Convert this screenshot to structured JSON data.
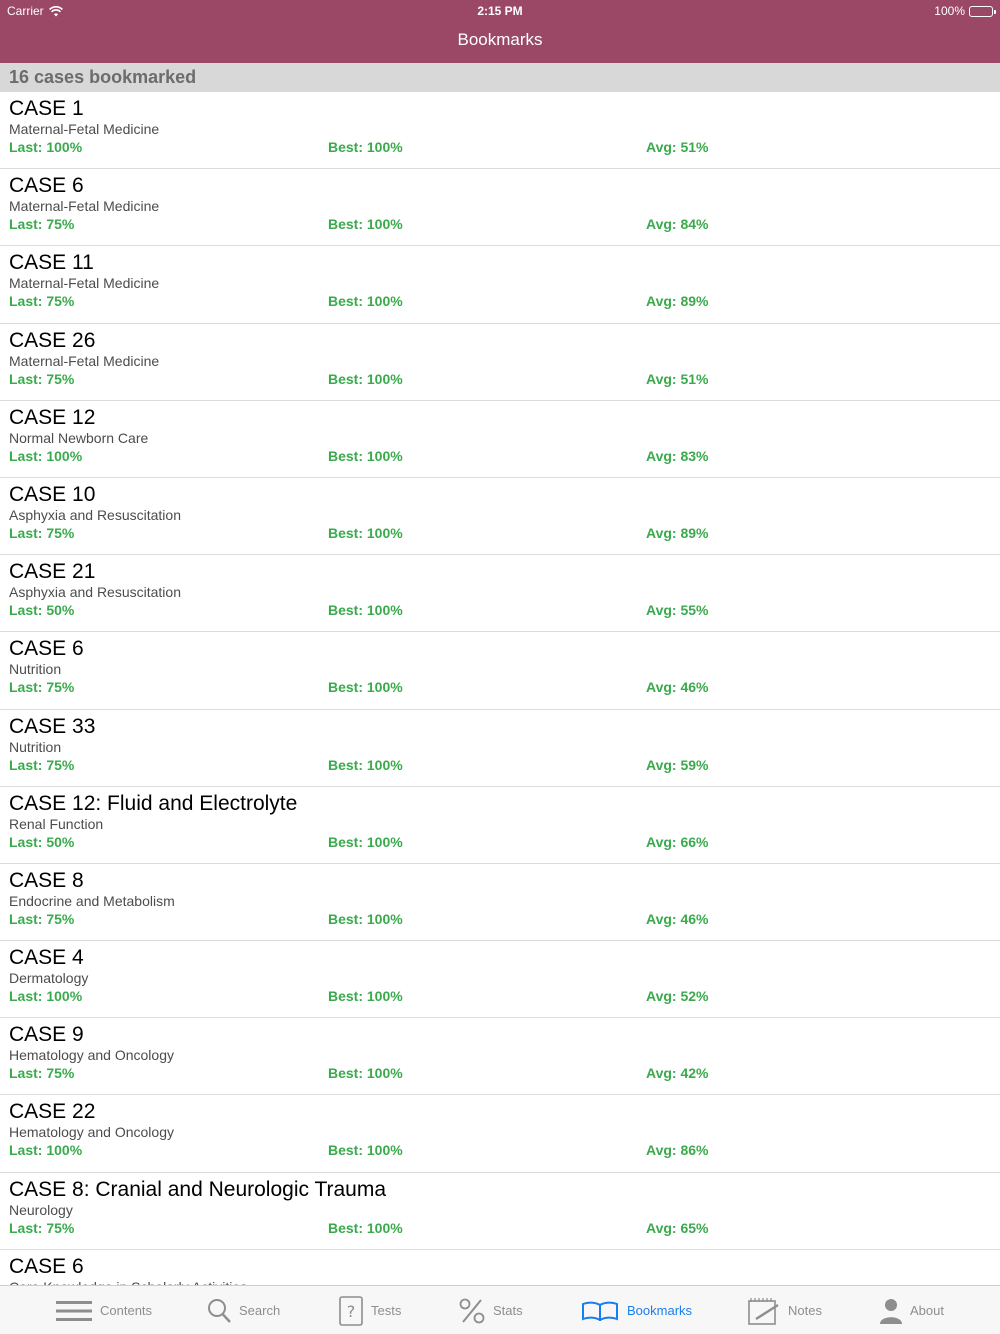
{
  "status_bar": {
    "carrier": "Carrier",
    "time": "2:15 PM",
    "battery": "100%"
  },
  "nav": {
    "title": "Bookmarks"
  },
  "section_header": "16 cases bookmarked",
  "rows": [
    {
      "title": "CASE 1",
      "subtitle": "Maternal-Fetal Medicine",
      "last": "Last: 100%",
      "best": "Best: 100%",
      "avg": "Avg: 51%"
    },
    {
      "title": "CASE 6",
      "subtitle": "Maternal-Fetal Medicine",
      "last": "Last: 75%",
      "best": "Best: 100%",
      "avg": "Avg: 84%"
    },
    {
      "title": "CASE 11",
      "subtitle": "Maternal-Fetal Medicine",
      "last": "Last: 75%",
      "best": "Best: 100%",
      "avg": "Avg: 89%"
    },
    {
      "title": "CASE 26",
      "subtitle": "Maternal-Fetal Medicine",
      "last": "Last: 75%",
      "best": "Best: 100%",
      "avg": "Avg: 51%"
    },
    {
      "title": "CASE 12",
      "subtitle": "Normal Newborn Care",
      "last": "Last: 100%",
      "best": "Best: 100%",
      "avg": "Avg: 83%"
    },
    {
      "title": "CASE 10",
      "subtitle": "Asphyxia and Resuscitation",
      "last": "Last: 75%",
      "best": "Best: 100%",
      "avg": "Avg: 89%"
    },
    {
      "title": "CASE 21",
      "subtitle": "Asphyxia and Resuscitation",
      "last": "Last: 50%",
      "best": "Best: 100%",
      "avg": "Avg: 55%"
    },
    {
      "title": "CASE 6",
      "subtitle": "Nutrition",
      "last": "Last: 75%",
      "best": "Best: 100%",
      "avg": "Avg: 46%"
    },
    {
      "title": "CASE 33",
      "subtitle": "Nutrition",
      "last": "Last: 75%",
      "best": "Best: 100%",
      "avg": "Avg: 59%"
    },
    {
      "title": "CASE 12: Fluid and Electrolyte",
      "subtitle": "Renal Function",
      "last": "Last: 50%",
      "best": "Best: 100%",
      "avg": "Avg: 66%"
    },
    {
      "title": "CASE 8",
      "subtitle": "Endocrine and Metabolism",
      "last": "Last: 75%",
      "best": "Best: 100%",
      "avg": "Avg: 46%"
    },
    {
      "title": "CASE 4",
      "subtitle": "Dermatology",
      "last": "Last: 100%",
      "best": "Best: 100%",
      "avg": "Avg: 52%"
    },
    {
      "title": "CASE 9",
      "subtitle": "Hematology and Oncology",
      "last": "Last: 75%",
      "best": "Best: 100%",
      "avg": "Avg: 42%"
    },
    {
      "title": "CASE 22",
      "subtitle": "Hematology and Oncology",
      "last": "Last: 100%",
      "best": "Best: 100%",
      "avg": "Avg: 86%"
    },
    {
      "title": "CASE 8: Cranial and Neurologic Trauma",
      "subtitle": "Neurology",
      "last": "Last: 75%",
      "best": "Best: 100%",
      "avg": "Avg: 65%"
    },
    {
      "title": "CASE 6",
      "subtitle": "Core Knowledge in Scholarly Activities",
      "last": "",
      "best": "",
      "avg": ""
    }
  ],
  "tabs": [
    {
      "label": "Contents",
      "icon": "list-icon",
      "active": false
    },
    {
      "label": "Search",
      "icon": "search-icon",
      "active": false
    },
    {
      "label": "Tests",
      "icon": "question-icon",
      "active": false
    },
    {
      "label": "Stats",
      "icon": "percent-icon",
      "active": false
    },
    {
      "label": "Bookmarks",
      "icon": "book-icon",
      "active": true
    },
    {
      "label": "Notes",
      "icon": "notepad-icon",
      "active": false
    },
    {
      "label": "About",
      "icon": "person-icon",
      "active": false
    }
  ],
  "colors": {
    "nav_bar": "#9a4866",
    "section_header_bg": "#d8d8d8",
    "stat_green": "#3aaa4d",
    "tab_active": "#1a7ef0",
    "tab_inactive": "#8e8e8e"
  }
}
